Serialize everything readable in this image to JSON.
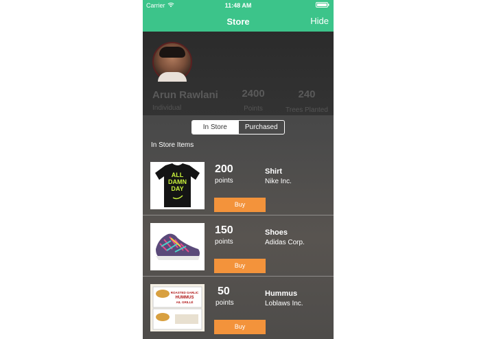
{
  "status_bar": {
    "carrier": "Carrier",
    "time": "11:48 AM"
  },
  "navbar": {
    "title": "Store",
    "hide_label": "Hide",
    "color": "#3cc48a"
  },
  "profile": {
    "name": "Arun Rawlani",
    "type": "Individual",
    "stats": [
      {
        "value": "2400",
        "label": "Points"
      },
      {
        "value": "240",
        "label": "Trees Planted"
      }
    ]
  },
  "segments": {
    "in_store": "In Store",
    "purchased": "Purchased",
    "selected": "Purchased"
  },
  "section_title": "In Store Items",
  "items": [
    {
      "points": "200",
      "points_label": "points",
      "name": "Shirt",
      "brand": "Nike Inc.",
      "buy_label": "Buy",
      "image_text": [
        "ALL",
        "DAMN",
        "DAY"
      ]
    },
    {
      "points": "150",
      "points_label": "points",
      "name": "Shoes",
      "brand": "Adidas Corp.",
      "buy_label": "Buy"
    },
    {
      "points": "50",
      "points_label": "points",
      "name": "Hummus",
      "brand": "Loblaws Inc.",
      "buy_label": "Buy",
      "image_text": [
        "ROASTED GARLIC",
        "HUMMUS",
        "AIL GRILLÉ"
      ]
    }
  ],
  "colors": {
    "buy_button": "#f3933b",
    "background_dark": "#3a3a3a"
  }
}
